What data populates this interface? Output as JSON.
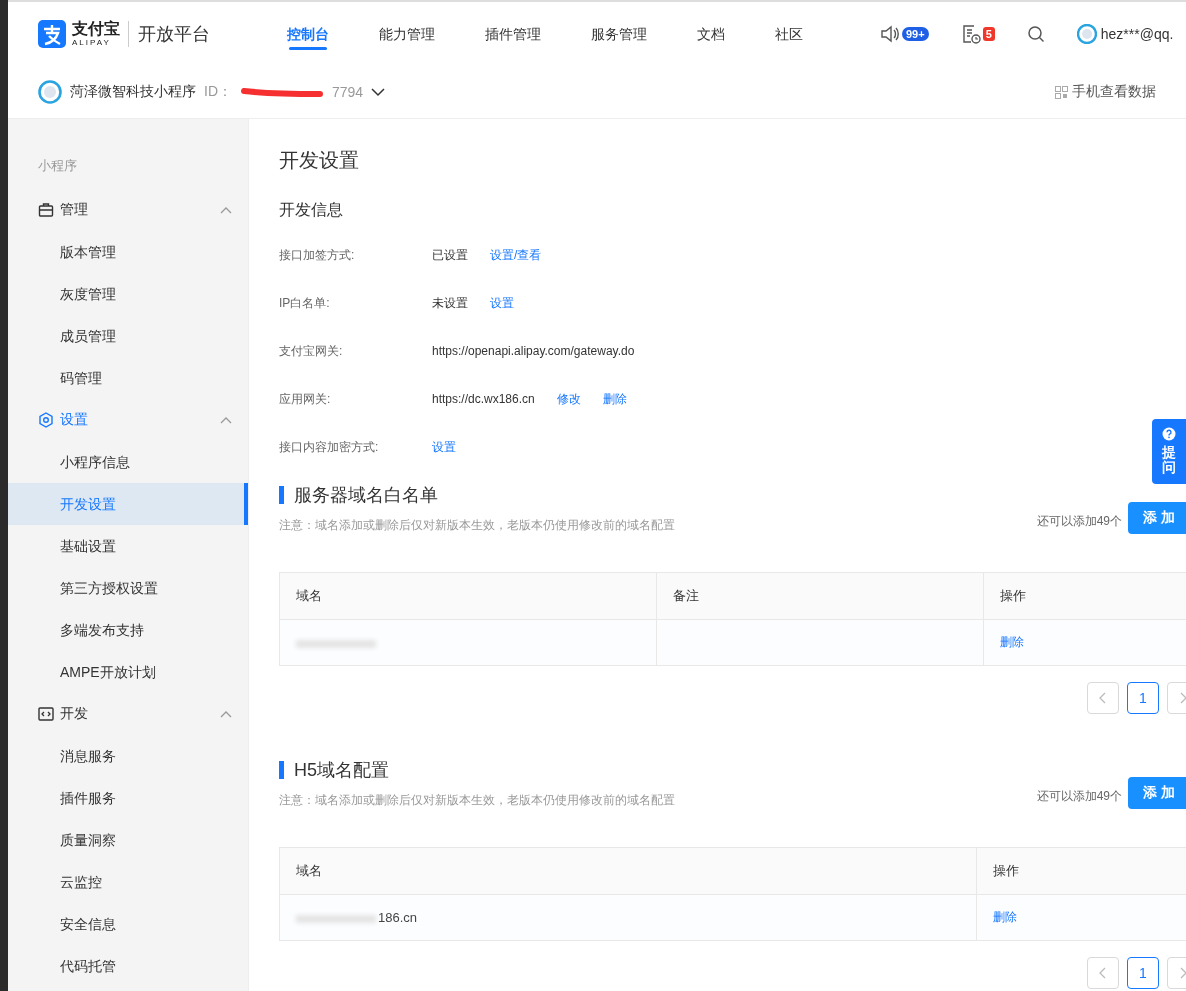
{
  "header": {
    "brand": "支付宝",
    "brand_sub": "ALIPAY",
    "platform": "开放平台",
    "nav": [
      {
        "label": "控制台",
        "selected": true
      },
      {
        "label": "能力管理",
        "selected": false
      },
      {
        "label": "插件管理",
        "selected": false
      },
      {
        "label": "服务管理",
        "selected": false
      },
      {
        "label": "文档",
        "selected": false
      },
      {
        "label": "社区",
        "selected": false
      }
    ],
    "notice_badge": "99+",
    "task_badge": "5",
    "user": "hez***@qq."
  },
  "app_bar": {
    "name": "菏泽微智科技小程序",
    "id_label": "ID：",
    "id_tail": "7794",
    "mobile_data": "手机查看数据"
  },
  "sidebar": {
    "title": "小程序",
    "groups": [
      {
        "label": "管理",
        "expanded": true,
        "selected": false,
        "items": [
          {
            "label": "版本管理",
            "selected": false
          },
          {
            "label": "灰度管理",
            "selected": false
          },
          {
            "label": "成员管理",
            "selected": false
          },
          {
            "label": "码管理",
            "selected": false
          }
        ]
      },
      {
        "label": "设置",
        "expanded": true,
        "selected": true,
        "items": [
          {
            "label": "小程序信息",
            "selected": false
          },
          {
            "label": "开发设置",
            "selected": true
          },
          {
            "label": "基础设置",
            "selected": false
          },
          {
            "label": "第三方授权设置",
            "selected": false
          },
          {
            "label": "多端发布支持",
            "selected": false
          },
          {
            "label": "AMPE开放计划",
            "selected": false
          }
        ]
      },
      {
        "label": "开发",
        "expanded": true,
        "selected": false,
        "items": [
          {
            "label": "消息服务",
            "selected": false
          },
          {
            "label": "插件服务",
            "selected": false
          },
          {
            "label": "质量洞察",
            "selected": false
          },
          {
            "label": "云监控",
            "selected": false
          },
          {
            "label": "安全信息",
            "selected": false
          },
          {
            "label": "代码托管",
            "selected": false
          }
        ]
      }
    ]
  },
  "page_title": "开发设置",
  "dev_info": {
    "title": "开发信息",
    "rows": [
      {
        "label": "接口加签方式:",
        "value": "已设置",
        "links": [
          "设置/查看"
        ]
      },
      {
        "label": "IP白名单:",
        "value": "未设置",
        "links": [
          "设置"
        ]
      },
      {
        "label": "支付宝网关:",
        "value": "https://openapi.alipay.com/gateway.do",
        "links": []
      },
      {
        "label": "应用网关:",
        "value": "https://dc.wx186.cn",
        "links": [
          "修改",
          "删除"
        ]
      },
      {
        "label": "接口内容加密方式:",
        "links": [
          "设置"
        ]
      }
    ]
  },
  "sections": [
    {
      "title": "服务器域名白名单",
      "note": "注意：域名添加或删除后仅对新版本生效，老版本仍使用修改前的域名配置",
      "remaining": "还可以添加49个",
      "add_button": "添 加",
      "columns": [
        "域名",
        "备注",
        "操作"
      ],
      "rows": [
        {
          "remark": "",
          "action": "删除"
        }
      ],
      "pages": [
        {
          "label": "1",
          "selected": true
        }
      ]
    },
    {
      "title": "H5域名配置",
      "note": "注意：域名添加或删除后仅对新版本生效，老版本仍使用修改前的域名配置",
      "remaining": "还可以添加49个",
      "add_button": "添 加",
      "columns": [
        "域名",
        "操作"
      ],
      "rows": [
        {
          "domain": "186.cn",
          "action": "删除"
        }
      ],
      "pages": [
        {
          "label": "1",
          "selected": true
        }
      ]
    }
  ],
  "help_tab": {
    "label": "提问"
  }
}
